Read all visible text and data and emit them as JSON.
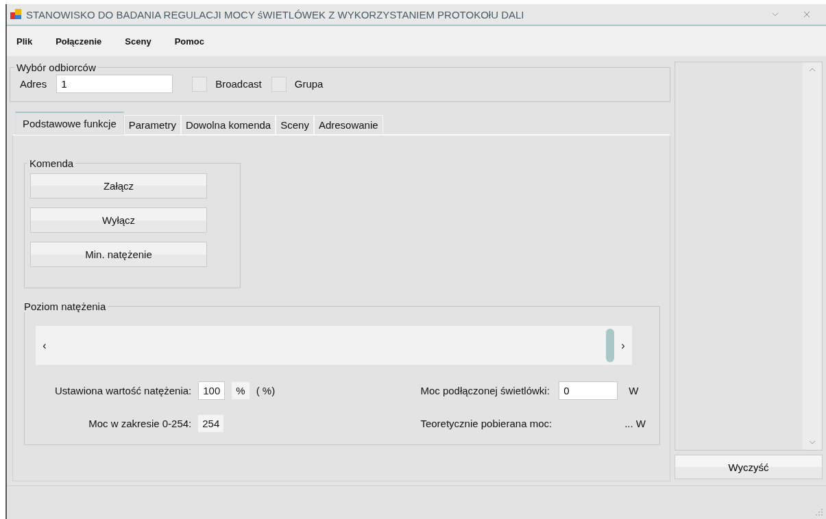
{
  "window": {
    "title": "STANOWISKO DO BADANIA REGULACJI MOCY śWIETLÓWEK Z WYKORZYSTANIEM PROTOKOłU DALI"
  },
  "menu": [
    "Plik",
    "Połączenie",
    "Sceny",
    "Pomoc"
  ],
  "recipients": {
    "title": "Wybór odbiorców",
    "address_label": "Adres",
    "address_value": "1",
    "options": [
      {
        "label": "Broadcast",
        "checked": false
      },
      {
        "label": "Grupa",
        "checked": false
      }
    ]
  },
  "tabs": [
    {
      "label": "Podstawowe funkcje",
      "selected": true
    },
    {
      "label": "Parametry",
      "selected": false
    },
    {
      "label": "Dowolna komenda",
      "selected": false
    },
    {
      "label": "Sceny",
      "selected": false
    },
    {
      "label": "Adresowanie",
      "selected": false
    }
  ],
  "command": {
    "title": "Komenda",
    "buttons": [
      "Załącz",
      "Wyłącz",
      "Min. natężenie"
    ]
  },
  "intensity": {
    "title": "Poziom natężenia",
    "scrollbar": {
      "left": "‹",
      "right": "›"
    },
    "set_label": "Ustawiona wartość natężenia:",
    "set_value": "100",
    "set_unit": "%",
    "set_note": "( %)",
    "range_label": "Moc w zakresie 0-254:",
    "range_value": "254",
    "power_label": "Moc podłączonej świetlówki:",
    "power_value": "0",
    "power_unit": "W",
    "theory_label": "Teoretycznie pobierana moc:",
    "theory_value": "... W"
  },
  "clear_button": "Wyczyść"
}
